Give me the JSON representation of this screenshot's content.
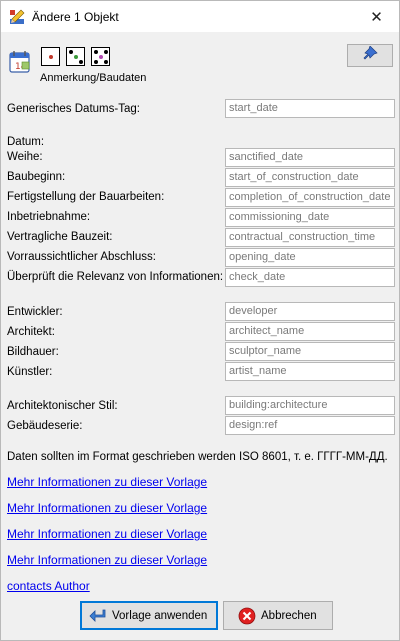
{
  "window": {
    "title": "Ändere 1 Objekt",
    "close_glyph": "✕",
    "app_icon": "josm-pencil-icon"
  },
  "preset_header": {
    "icons": [
      "calendar-icon",
      "dice-one-icon",
      "dice-three-icon",
      "dice-five-icon"
    ],
    "caption": "Anmerkung/Baudaten",
    "pin_icon": "pin-icon"
  },
  "fields_generic": {
    "label": "Generisches Datums-Tag:",
    "value": "start_date"
  },
  "section_date": {
    "heading": "Datum:",
    "rows": [
      {
        "label": "Weihe:",
        "value": "sanctified_date"
      },
      {
        "label": "Baubeginn:",
        "value": "start_of_construction_date"
      },
      {
        "label": "Fertigstellung der Bauarbeiten:",
        "value": "completion_of_construction_date"
      },
      {
        "label": "Inbetriebnahme:",
        "value": "commissioning_date"
      },
      {
        "label": "Vertragliche Bauzeit:",
        "value": "contractual_construction_time"
      },
      {
        "label": "Vorraussichtlicher Abschluss:",
        "value": "opening_date"
      },
      {
        "label": "Überprüft die Relevanz von Informationen:",
        "value": "check_date"
      }
    ]
  },
  "section_people": {
    "rows": [
      {
        "label": "Entwickler:",
        "value": "developer"
      },
      {
        "label": "Architekt:",
        "value": "architect_name"
      },
      {
        "label": "Bildhauer:",
        "value": "sculptor_name"
      },
      {
        "label": "Künstler:",
        "value": "artist_name"
      }
    ]
  },
  "section_style": {
    "rows": [
      {
        "label": "Architektonischer Stil:",
        "value": "building:architecture"
      },
      {
        "label": "Gebäudeserie:",
        "value": "design:ref"
      }
    ]
  },
  "note": "Daten sollten im Format geschrieben werden ISO 8601, т. е. ГГГГ-ММ-ДД.",
  "links": [
    "Mehr Informationen zu dieser Vorlage",
    "Mehr Informationen zu dieser Vorlage",
    "Mehr Informationen zu dieser Vorlage",
    "Mehr Informationen zu dieser Vorlage",
    "contacts Author"
  ],
  "buttons": {
    "apply_label": "Vorlage anwenden",
    "apply_icon": "arrow-apply-icon",
    "cancel_label": "Abbrechen",
    "cancel_icon": "cancel-x-icon"
  },
  "colors": {
    "link": "#0000ee",
    "cancel_red": "#e02020",
    "apply_blue": "#3c7fd3"
  }
}
